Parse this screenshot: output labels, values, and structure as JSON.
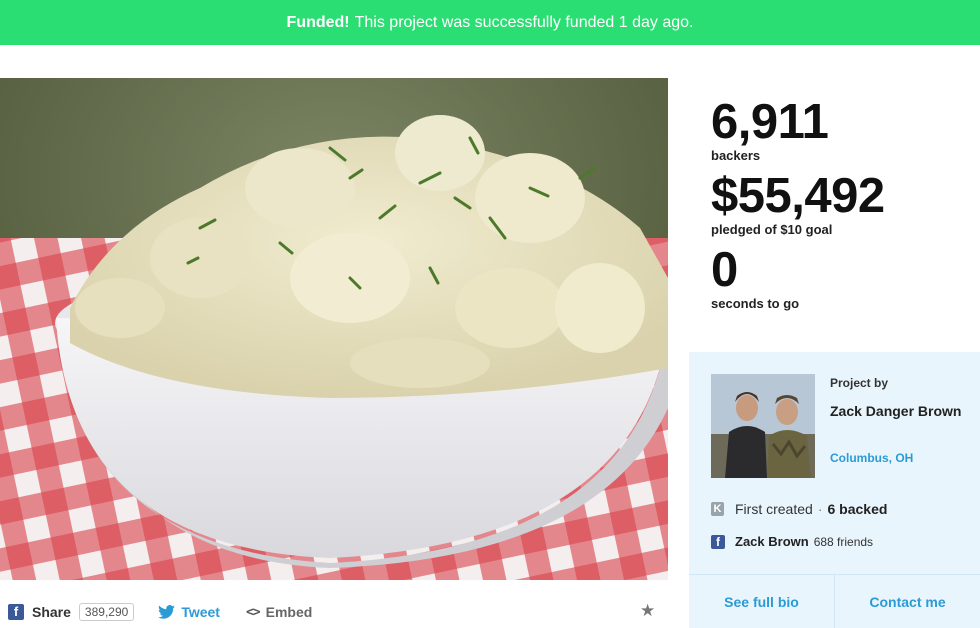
{
  "banner": {
    "strong": "Funded!",
    "text": "This project was successfully funded 1 day ago."
  },
  "stats": {
    "backers_value": "6,911",
    "backers_label": "backers",
    "pledged_value": "$55,492",
    "pledged_label": "pledged of $10 goal",
    "time_value": "0",
    "time_label": "seconds to go"
  },
  "creator": {
    "project_by": "Project by",
    "name": "Zack Danger Brown",
    "location": "Columbus, OH",
    "first_created": "First created",
    "backed": "6 backed",
    "fb_name": "Zack Brown",
    "fb_friends": "688 friends",
    "see_bio": "See full bio",
    "contact": "Contact me"
  },
  "share": {
    "facebook_label": "Share",
    "facebook_count": "389,290",
    "tweet_label": "Tweet",
    "embed_label": "Embed"
  },
  "icons": {
    "facebook": "facebook-icon",
    "twitter": "twitter-icon",
    "embed": "code-icon",
    "kickstarter": "kickstarter-icon",
    "star": "star-icon"
  },
  "colors": {
    "banner": "#2bde73",
    "link": "#2a9bd6",
    "creator_bg": "#e9f5fc",
    "facebook": "#3b5998"
  }
}
